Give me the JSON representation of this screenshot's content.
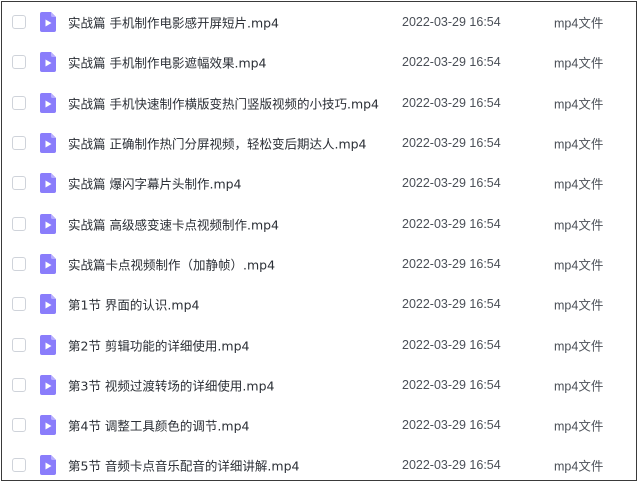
{
  "colors": {
    "icon_fill": "#8a7dfb",
    "icon_fold": "#b7adff",
    "icon_play": "#ffffff",
    "checkbox_border": "#cfd3da",
    "text_primary": "#2b2f36",
    "text_secondary": "#4a4f57"
  },
  "file_icon": "video-file-icon",
  "files": [
    {
      "name": "实战篇 手机制作电影感开屏短片.mp4",
      "date": "2022-03-29 16:54",
      "type": "mp4文件"
    },
    {
      "name": "实战篇 手机制作电影遮幅效果.mp4",
      "date": "2022-03-29 16:54",
      "type": "mp4文件"
    },
    {
      "name": "实战篇 手机快速制作横版变热门竖版视频的小技巧.mp4",
      "date": "2022-03-29 16:54",
      "type": "mp4文件"
    },
    {
      "name": "实战篇 正确制作热门分屏视频，轻松变后期达人.mp4",
      "date": "2022-03-29 16:54",
      "type": "mp4文件"
    },
    {
      "name": "实战篇 爆闪字幕片头制作.mp4",
      "date": "2022-03-29 16:54",
      "type": "mp4文件"
    },
    {
      "name": "实战篇 高级感变速卡点视频制作.mp4",
      "date": "2022-03-29 16:54",
      "type": "mp4文件"
    },
    {
      "name": "实战篇卡点视频制作（加静帧）.mp4",
      "date": "2022-03-29 16:54",
      "type": "mp4文件"
    },
    {
      "name": "第1节 界面的认识.mp4",
      "date": "2022-03-29 16:54",
      "type": "mp4文件"
    },
    {
      "name": "第2节 剪辑功能的详细使用.mp4",
      "date": "2022-03-29 16:54",
      "type": "mp4文件"
    },
    {
      "name": "第3节 视频过渡转场的详细使用.mp4",
      "date": "2022-03-29 16:54",
      "type": "mp4文件"
    },
    {
      "name": "第4节  调整工具颜色的调节.mp4",
      "date": "2022-03-29 16:54",
      "type": "mp4文件"
    },
    {
      "name": "第5节  音频卡点音乐配音的详细讲解.mp4",
      "date": "2022-03-29 16:54",
      "type": "mp4文件"
    }
  ]
}
